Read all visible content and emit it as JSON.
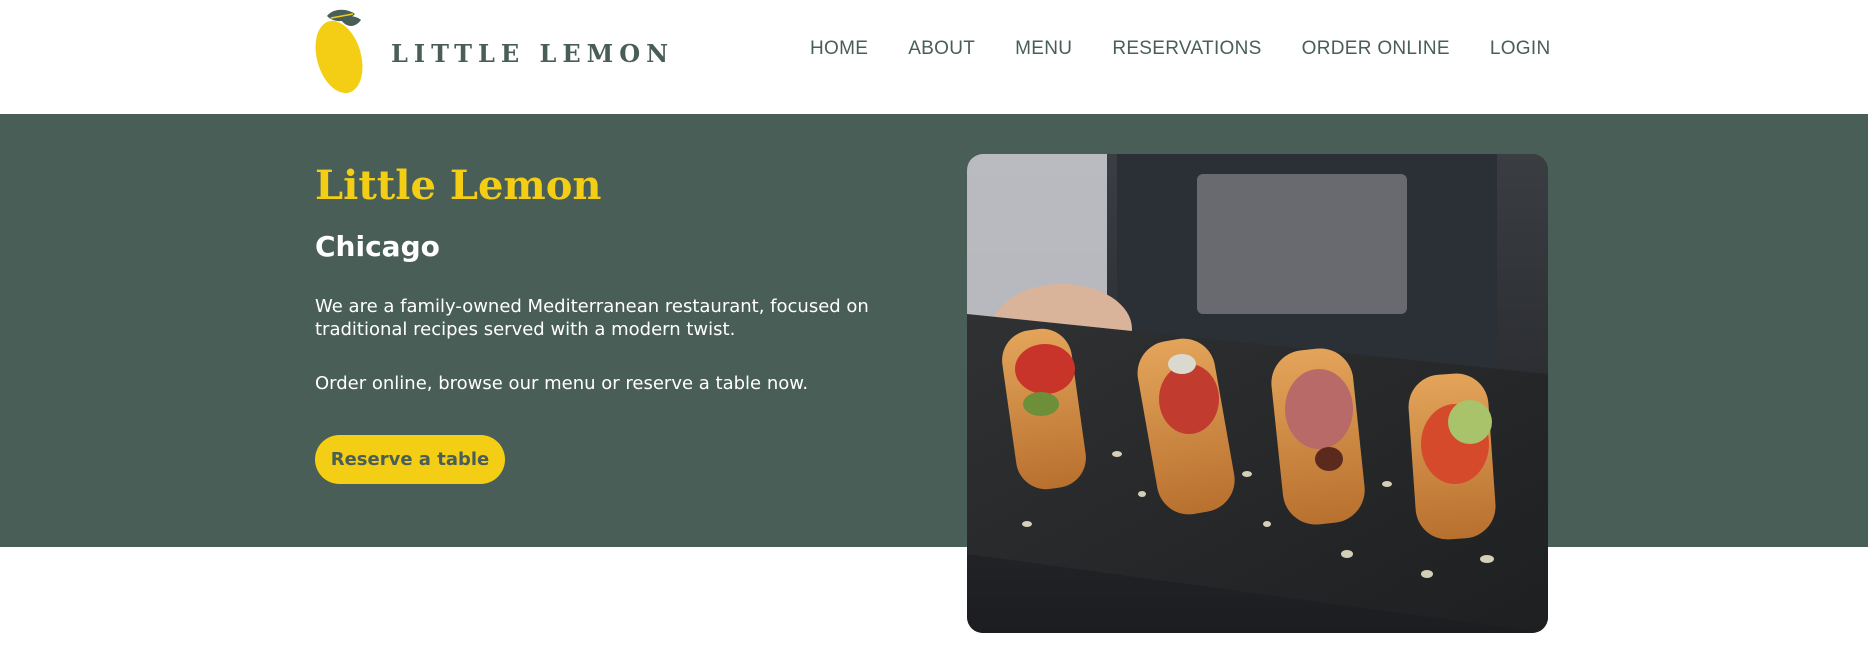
{
  "brand": {
    "logo_text": "LITTLE LEMON",
    "logo_icon": "lemon-logo-icon",
    "accent_yellow": "#f4ce14",
    "brand_green": "#495e57"
  },
  "nav": {
    "items": [
      {
        "label": "HOME"
      },
      {
        "label": "ABOUT"
      },
      {
        "label": "MENU"
      },
      {
        "label": "RESERVATIONS"
      },
      {
        "label": "ORDER ONLINE"
      },
      {
        "label": "LOGIN"
      }
    ]
  },
  "hero": {
    "title": "Little Lemon",
    "subtitle": "Chicago",
    "description": "We are a family-owned Mediterranean restaurant, focused on traditional recipes served with a modern twist.",
    "cta_text": "Order online, browse our menu or reserve a table now.",
    "reserve_button_label": "Reserve a table",
    "image_icon": "food-platter-image"
  }
}
